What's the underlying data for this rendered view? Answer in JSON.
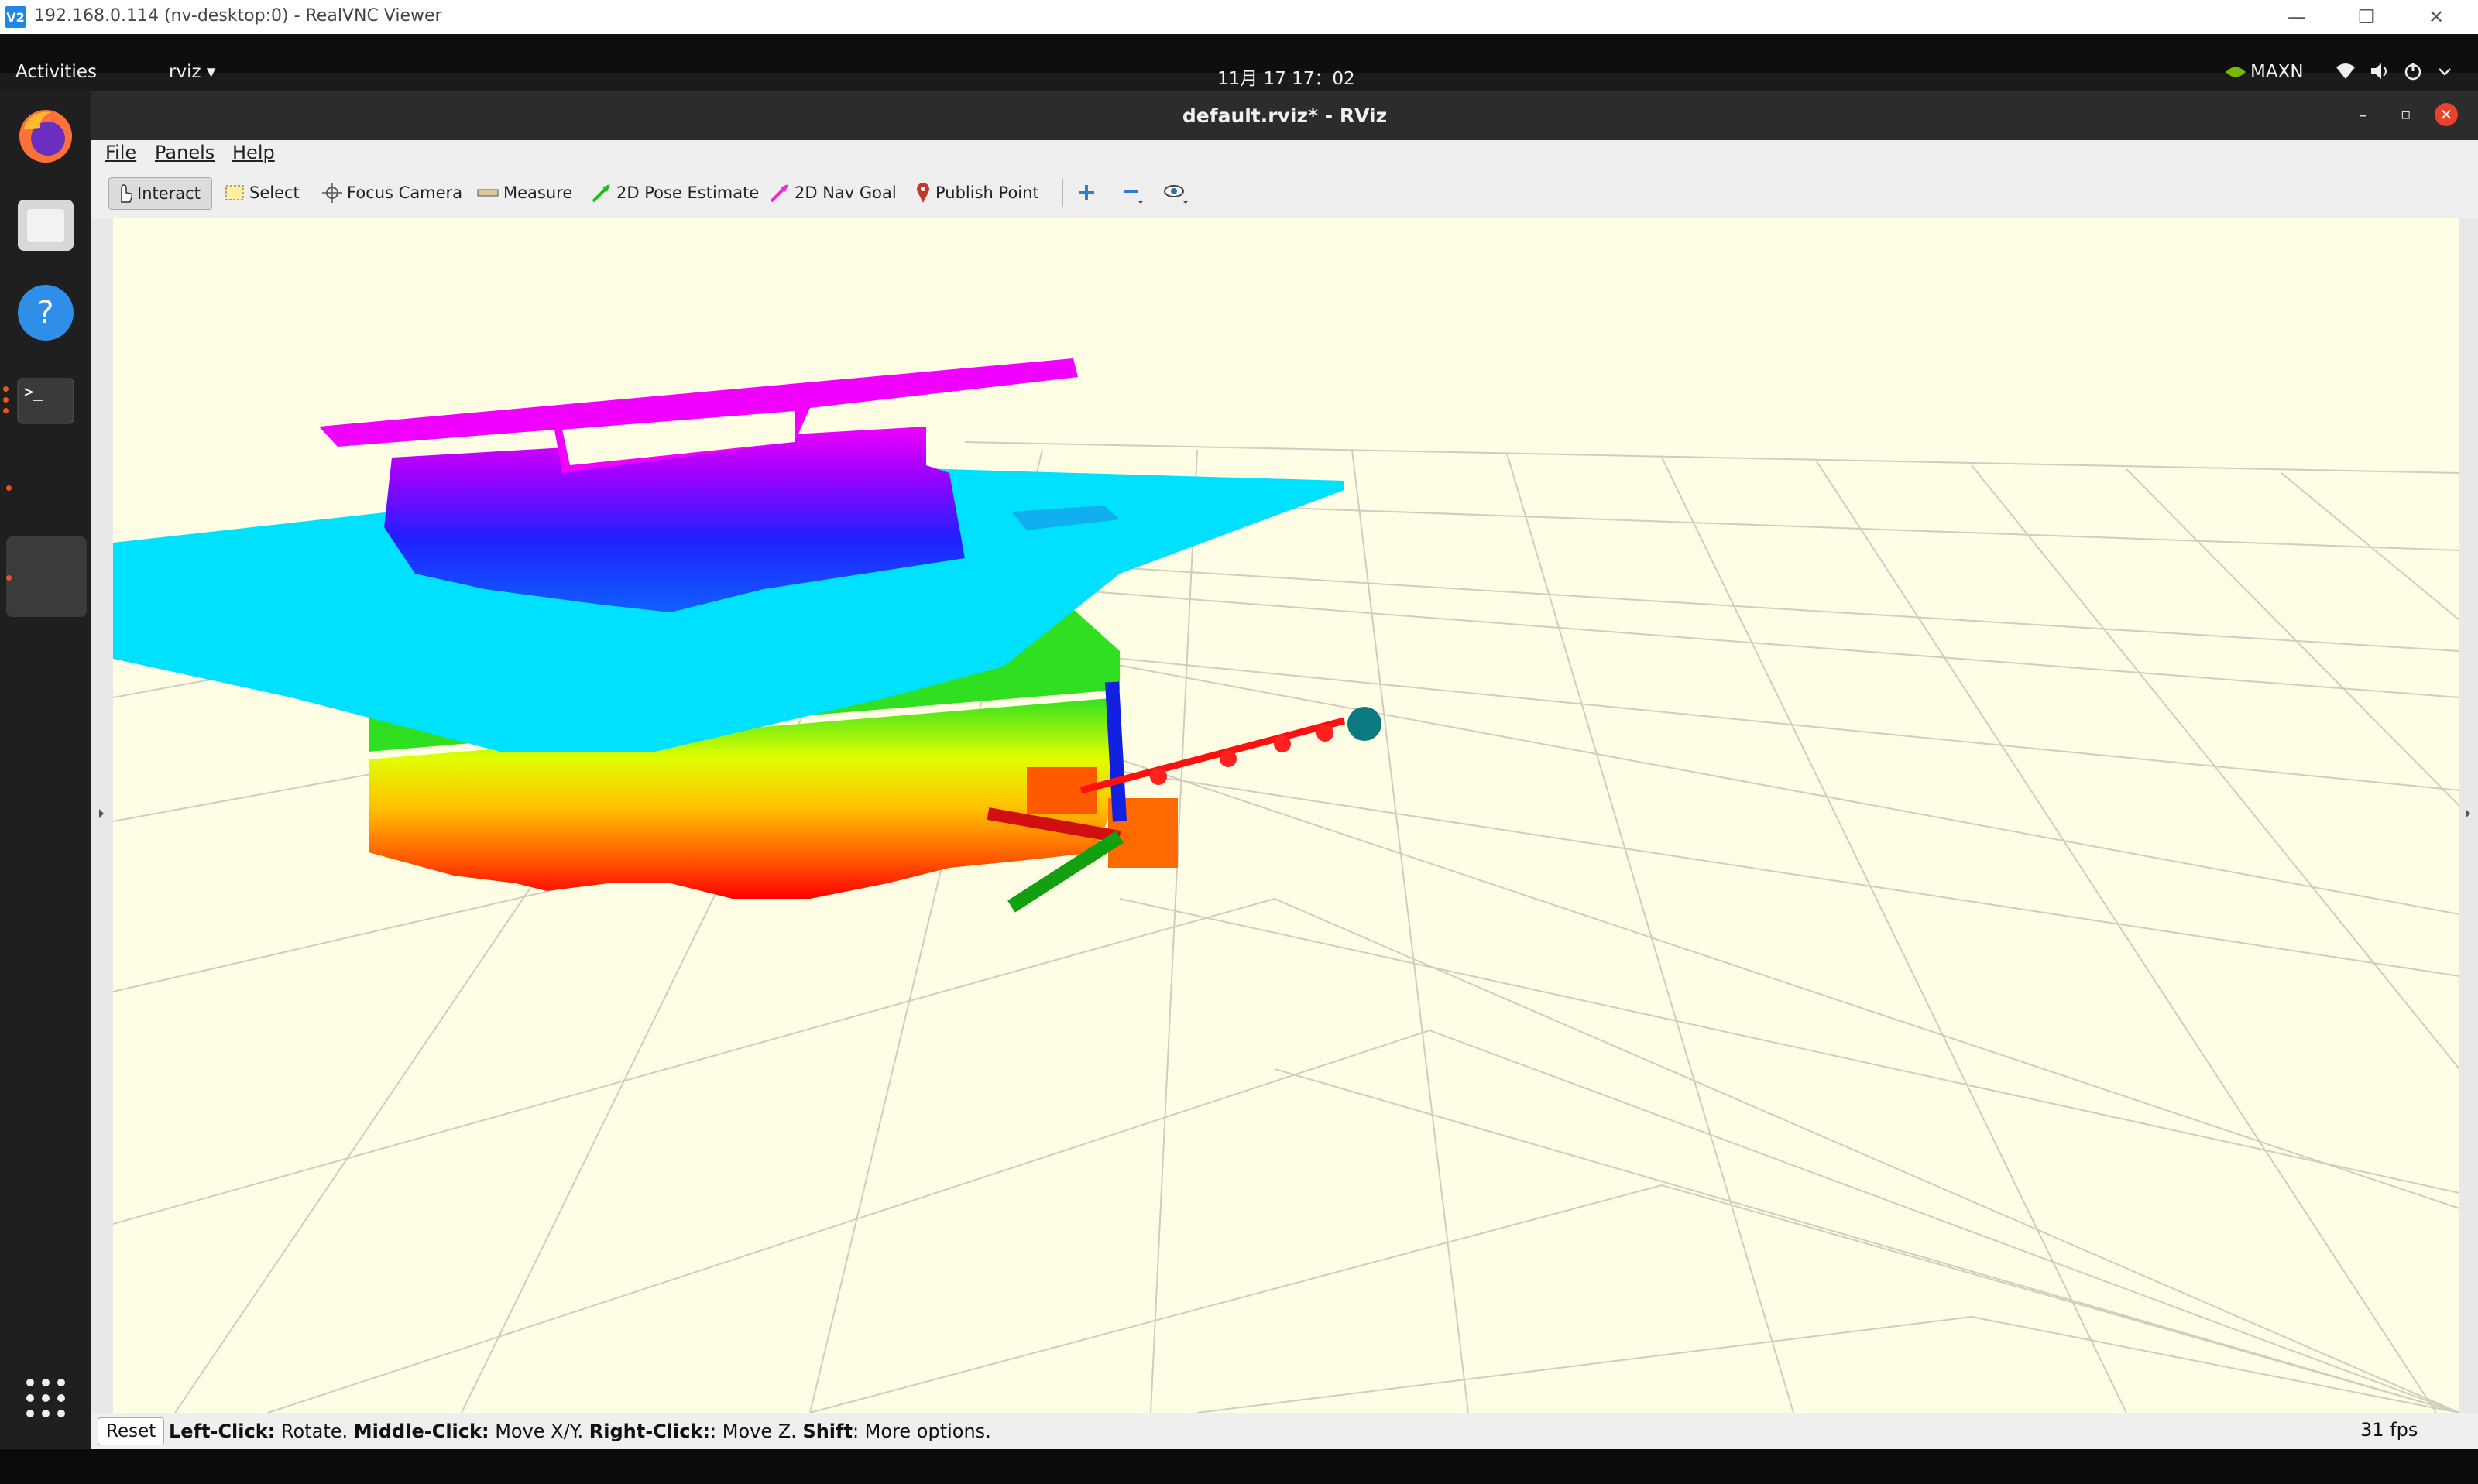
{
  "vnc": {
    "logo": "V2",
    "title": "192.168.0.114 (nv-desktop:0) - RealVNC Viewer",
    "minimize": "—",
    "restore": "❐",
    "close": "✕"
  },
  "gnome": {
    "activities": "Activities",
    "app_menu": "rviz ▾",
    "clock": "11月 17 17：02",
    "power_mode": "MAXN"
  },
  "dock": {
    "items": [
      "firefox-icon",
      "files-icon",
      "help-icon",
      "terminal-icon",
      "show-apps-icon"
    ]
  },
  "rviz": {
    "title": "default.rviz* - RViz",
    "menu": [
      "File",
      "Panels",
      "Help"
    ],
    "toolbar": [
      {
        "label": "Interact",
        "icon": "hand-icon"
      },
      {
        "label": "Select",
        "icon": "select-box-icon"
      },
      {
        "label": "Focus Camera",
        "icon": "crosshair-icon"
      },
      {
        "label": "Measure",
        "icon": "ruler-icon"
      },
      {
        "label": "2D Pose Estimate",
        "icon": "green-arrow-icon"
      },
      {
        "label": "2D Nav Goal",
        "icon": "pink-arrow-icon"
      },
      {
        "label": "Publish Point",
        "icon": "map-pin-icon"
      }
    ],
    "status": {
      "reset": "Reset",
      "b1": "Left-Click:",
      "t1": " Rotate. ",
      "b2": "Middle-Click:",
      "t2": " Move X/Y. ",
      "b3": "Right-Click:",
      "t3": ": Move Z. ",
      "b4": "Shift",
      "t4": ": More options.",
      "fps": "31 fps"
    }
  },
  "colors": {
    "viewport_bg": "#fffde3",
    "grid": "#c9c7b8",
    "cyan_plane": "#00e0ff",
    "magenta": "#ff00ff"
  }
}
